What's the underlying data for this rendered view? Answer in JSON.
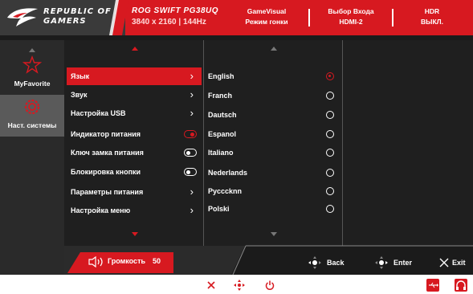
{
  "colors": {
    "accent": "#d71920",
    "background": "#1b1b1b",
    "sidebar": "#2a2a2a",
    "selected_sidebar": "#5a5a5a"
  },
  "header": {
    "brand_line1": "REPUBLIC OF",
    "brand_line2": "GAMERS",
    "model": "ROG SWIFT PG38UQ",
    "resolution": "3840 x 2160 | 144Hz",
    "status": [
      {
        "line1": "GameVisual",
        "line2": "Режим гонки"
      },
      {
        "line1": "Выбор Входа",
        "line2": "HDMI-2"
      },
      {
        "line1": "HDR",
        "line2": "ВЫКЛ."
      }
    ]
  },
  "sidebar": {
    "items": [
      {
        "label": "MyFavorite",
        "icon": "star-icon",
        "selected": false
      },
      {
        "label": "Наст. системы",
        "icon": "gear-icon",
        "selected": true
      }
    ]
  },
  "menu": {
    "items": [
      {
        "label": "Язык",
        "control": "chevron",
        "selected": true
      },
      {
        "label": "Звук",
        "control": "chevron",
        "selected": false
      },
      {
        "label": "Настройка USB",
        "control": "chevron",
        "selected": false
      },
      {
        "label": "Индикатор питания",
        "control": "toggle-on",
        "selected": false
      },
      {
        "label": "Ключ замка питания",
        "control": "toggle-off",
        "selected": false
      },
      {
        "label": "Блокировка кнопки",
        "control": "toggle-off",
        "selected": false
      },
      {
        "label": "Параметры питания",
        "control": "chevron",
        "selected": false
      },
      {
        "label": "Настройка меню",
        "control": "chevron",
        "selected": false
      }
    ]
  },
  "languages": {
    "items": [
      {
        "label": "English",
        "checked": true
      },
      {
        "label": "Franch",
        "checked": false
      },
      {
        "label": "Dautsch",
        "checked": false
      },
      {
        "label": "Espanol",
        "checked": false
      },
      {
        "label": "Italiano",
        "checked": false
      },
      {
        "label": "Nederlands",
        "checked": false
      },
      {
        "label": "Pycccknn",
        "checked": false
      },
      {
        "label": "Polski",
        "checked": false
      }
    ]
  },
  "footer": {
    "volume_label": "Громкость",
    "volume_value": "50",
    "nav": {
      "back": "Back",
      "enter": "Enter",
      "exit": "Exit"
    }
  },
  "keys": [
    "close-icon",
    "five-way-nav-icon",
    "power-icon",
    "usb-icon",
    "headset-icon"
  ]
}
